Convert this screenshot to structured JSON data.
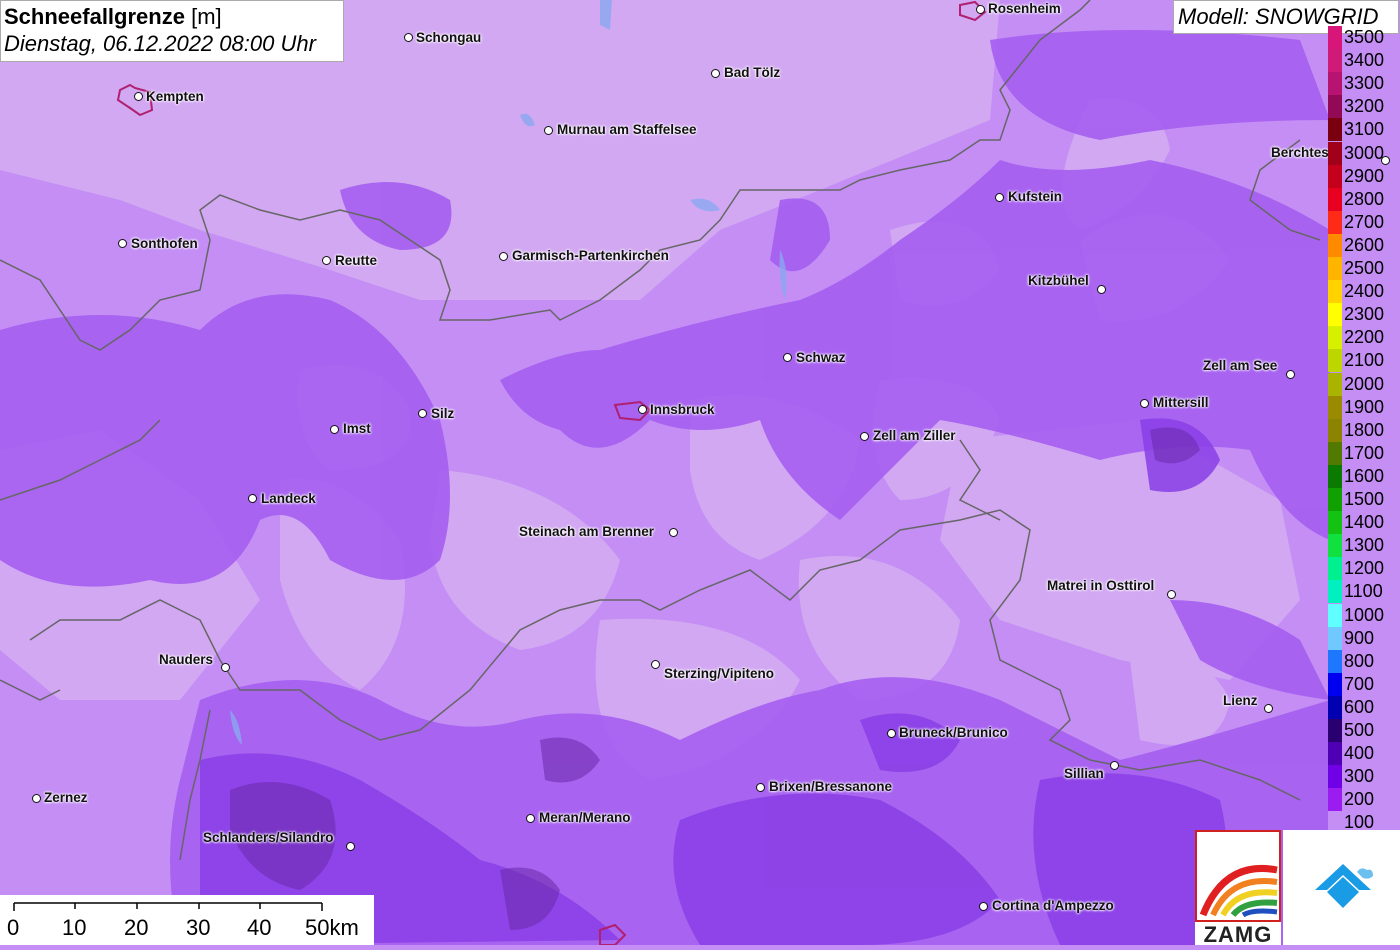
{
  "header": {
    "title": "Schneefallgrenze",
    "unit": "[m]",
    "datetime": "Dienstag, 06.12.2022 08:00 Uhr",
    "model": "Modell: SNOWGRID"
  },
  "legend": {
    "entries": [
      {
        "label": "3500",
        "color": "#d8167a"
      },
      {
        "label": "3400",
        "color": "#d01a78"
      },
      {
        "label": "3300",
        "color": "#b61470"
      },
      {
        "label": "3200",
        "color": "#920a56"
      },
      {
        "label": "3100",
        "color": "#7a0010"
      },
      {
        "label": "3000",
        "color": "#a0001a"
      },
      {
        "label": "2900",
        "color": "#c4001c"
      },
      {
        "label": "2800",
        "color": "#e80020"
      },
      {
        "label": "2700",
        "color": "#ff2a18"
      },
      {
        "label": "2600",
        "color": "#ff8a00"
      },
      {
        "label": "2500",
        "color": "#ffb400"
      },
      {
        "label": "2400",
        "color": "#ffd200"
      },
      {
        "label": "2300",
        "color": "#ffff00"
      },
      {
        "label": "2200",
        "color": "#d6f000"
      },
      {
        "label": "2100",
        "color": "#bcd600"
      },
      {
        "label": "2000",
        "color": "#a8b400"
      },
      {
        "label": "1900",
        "color": "#9a8a00"
      },
      {
        "label": "1800",
        "color": "#8c8400"
      },
      {
        "label": "1700",
        "color": "#527a00"
      },
      {
        "label": "1600",
        "color": "#0a7a00"
      },
      {
        "label": "1500",
        "color": "#10a000"
      },
      {
        "label": "1400",
        "color": "#14c214"
      },
      {
        "label": "1300",
        "color": "#10e040"
      },
      {
        "label": "1200",
        "color": "#00f090"
      },
      {
        "label": "1100",
        "color": "#00f0c0"
      },
      {
        "label": "1000",
        "color": "#60ffff"
      },
      {
        "label": "900",
        "color": "#70c8ff"
      },
      {
        "label": "800",
        "color": "#1e78ff"
      },
      {
        "label": "700",
        "color": "#0000f0"
      },
      {
        "label": "600",
        "color": "#0000b0"
      },
      {
        "label": "500",
        "color": "#2a0070"
      },
      {
        "label": "400",
        "color": "#5000b4"
      },
      {
        "label": "300",
        "color": "#7000e6"
      },
      {
        "label": "200",
        "color": "#9a1cf0"
      },
      {
        "label": "100",
        "color": "#c48ef5"
      }
    ]
  },
  "scale": {
    "ticks": [
      "0",
      "10",
      "20",
      "30",
      "40",
      "50km"
    ]
  },
  "logos": {
    "zamg_text": "ZAMG"
  },
  "cities": [
    {
      "name": "Schongau"
    },
    {
      "name": "Rosenheim"
    },
    {
      "name": "Kempten"
    },
    {
      "name": "Bad Tölz"
    },
    {
      "name": "Murnau am Staffelsee"
    },
    {
      "name": "Berchtes"
    },
    {
      "name": "Kufstein"
    },
    {
      "name": "Sonthofen"
    },
    {
      "name": "Reutte"
    },
    {
      "name": "Garmisch-Partenkirchen"
    },
    {
      "name": "Kitzbühel"
    },
    {
      "name": "Schwaz"
    },
    {
      "name": "Zell am See"
    },
    {
      "name": "Mittersill"
    },
    {
      "name": "Imst"
    },
    {
      "name": "Silz"
    },
    {
      "name": "Innsbruck"
    },
    {
      "name": "Zell am Ziller"
    },
    {
      "name": "Landeck"
    },
    {
      "name": "Steinach am Brenner"
    },
    {
      "name": "Matrei in Osttirol"
    },
    {
      "name": "Nauders"
    },
    {
      "name": "Sterzing/Vipiteno"
    },
    {
      "name": "Lienz"
    },
    {
      "name": "Bruneck/Brunico"
    },
    {
      "name": "Sillian"
    },
    {
      "name": "Zernez"
    },
    {
      "name": "Brixen/Bressanone"
    },
    {
      "name": "Meran/Merano"
    },
    {
      "name": "Schlanders/Silandro"
    },
    {
      "name": "Cortina d'Ampezzo"
    }
  ]
}
